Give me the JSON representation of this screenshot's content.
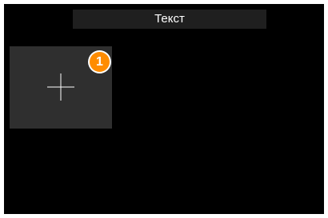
{
  "header": {
    "title": "Текст"
  },
  "tile": {
    "icon": "plus-icon",
    "badge_count": "1"
  },
  "colors": {
    "background": "#000000",
    "tile": "#2f2f2f",
    "badge": "#ff8c00",
    "title_bar": "#1f1f1f"
  }
}
